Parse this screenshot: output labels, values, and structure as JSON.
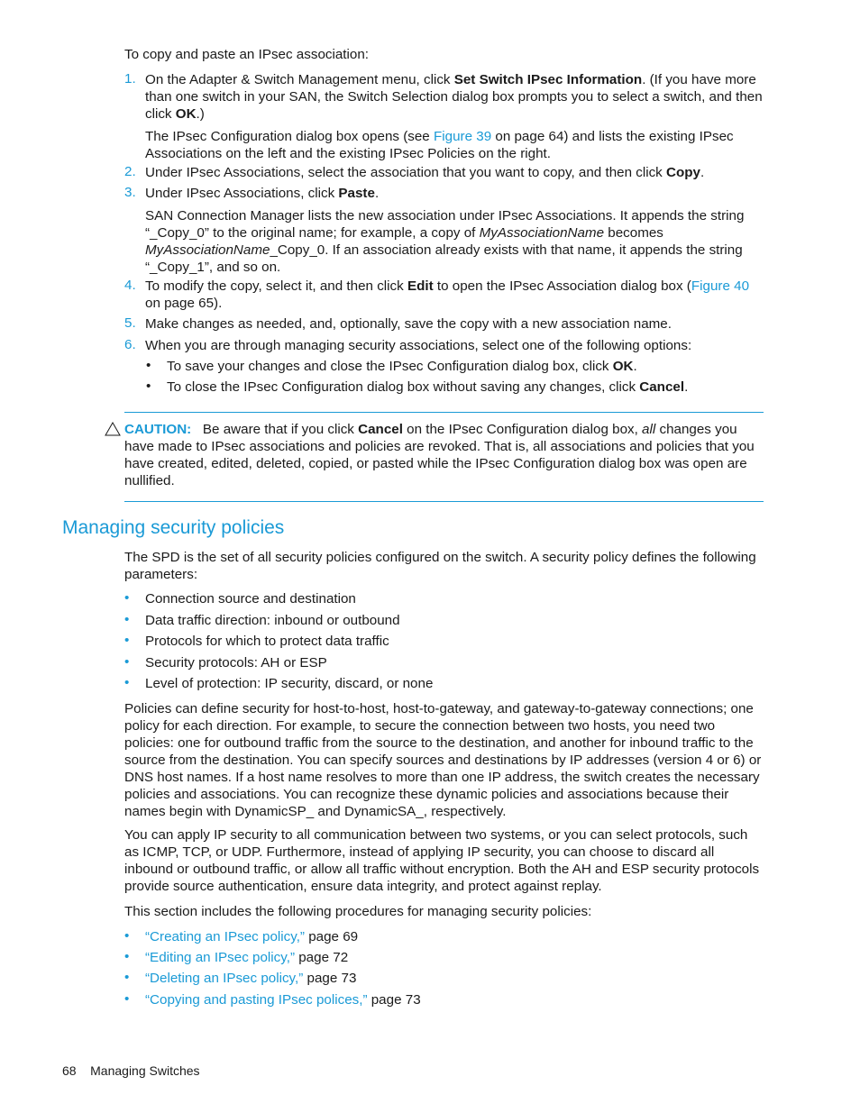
{
  "intro": "To copy and paste an IPsec association:",
  "steps": [
    {
      "num": "1.",
      "pre": "On the Adapter & Switch Management menu, click ",
      "bold": "Set Switch IPsec Information",
      "post": ". (If you have more than one switch in your SAN, the Switch Selection dialog box prompts you to select a switch, and then click ",
      "bold2": "OK",
      "post2": ".)",
      "note_pre": "The IPsec Configuration dialog box opens (see ",
      "note_link": "Figure 39",
      "note_post": " on page 64) and lists the existing IPsec Associations on the left and the existing IPsec Policies on the right."
    },
    {
      "num": "2.",
      "pre": "Under IPsec Associations, select the association that you want to copy, and then click ",
      "bold": "Copy",
      "post": "."
    },
    {
      "num": "3.",
      "pre": "Under IPsec Associations, click ",
      "bold": "Paste",
      "post": ".",
      "note_a": "SAN Connection Manager lists the new association under IPsec Associations. It appends the string “_Copy_0” to the original name; for example, a copy of ",
      "note_i1": "MyAssociationName",
      "note_b": " becomes ",
      "note_i2": "MyAssociationName",
      "note_c": "_Copy_0. If an association already exists with that name, it appends the string “_Copy_1”, and so on."
    },
    {
      "num": "4.",
      "pre": "To modify the copy, select it, and then click ",
      "bold": "Edit",
      "post": " to open the IPsec Association dialog box (",
      "link": "Figure 40",
      "post2": " on page 65)."
    },
    {
      "num": "5.",
      "pre": "Make changes as needed, and, optionally, save the copy with a new association name."
    },
    {
      "num": "6.",
      "pre": "When you are through managing security associations, select one of the following options:"
    }
  ],
  "step6_options": [
    {
      "pre": "To save your changes and close the IPsec Configuration dialog box, click ",
      "bold": "OK",
      "post": "."
    },
    {
      "pre": "To close the IPsec Configuration dialog box without saving any changes, click ",
      "bold": "Cancel",
      "post": "."
    }
  ],
  "caution": {
    "icon": "warning-triangle-icon",
    "label": "CAUTION:",
    "pre": "Be aware that if you click ",
    "bold": "Cancel",
    "mid": " on the IPsec Configuration dialog box, ",
    "italic": "all",
    "post": " changes you have made to IPsec associations and policies are revoked. That is, all associations and policies that you have created, edited, deleted, copied, or pasted while the IPsec Configuration dialog box was open are nullified."
  },
  "section": {
    "title": "Managing security policies",
    "intro": "The SPD is the set of all security policies configured on the switch. A security policy defines the following parameters:",
    "params": [
      "Connection source and destination",
      "Data traffic direction: inbound or outbound",
      "Protocols for which to protect data traffic",
      "Security protocols: AH or ESP",
      "Level of protection: IP security, discard, or none"
    ],
    "para1": "Policies can define security for host-to-host, host-to-gateway, and gateway-to-gateway connections; one policy for each direction. For example, to secure the connection between two hosts, you need two policies: one for outbound traffic from the source to the destination, and another for inbound traffic to the source from the destination. You can specify sources and destinations by IP addresses (version 4 or 6) or DNS host names. If a host name resolves to more than one IP address, the switch creates the necessary policies and associations. You can recognize these dynamic policies and associations because their names begin with DynamicSP_ and DynamicSA_, respectively.",
    "para2": "You can apply IP security to all communication between two systems, or you can select protocols, such as ICMP, TCP, or UDP. Furthermore, instead of applying IP security, you can choose to discard all inbound or outbound traffic, or allow all traffic without encryption. Both the AH and ESP security protocols provide source authentication, ensure data integrity, and protect against replay.",
    "para3": "This section includes the following procedures for managing security policies:",
    "procedures": [
      {
        "link": "“Creating an IPsec policy,”",
        "page": " page 69"
      },
      {
        "link": "“Editing an IPsec policy,”",
        "page": " page 72"
      },
      {
        "link": "“Deleting an IPsec policy,”",
        "page": " page 73"
      },
      {
        "link": "“Copying and pasting IPsec polices,”",
        "page": " page 73"
      }
    ]
  },
  "footer": {
    "page_number": "68",
    "chapter": "Managing Switches"
  },
  "bullet_char": "•"
}
